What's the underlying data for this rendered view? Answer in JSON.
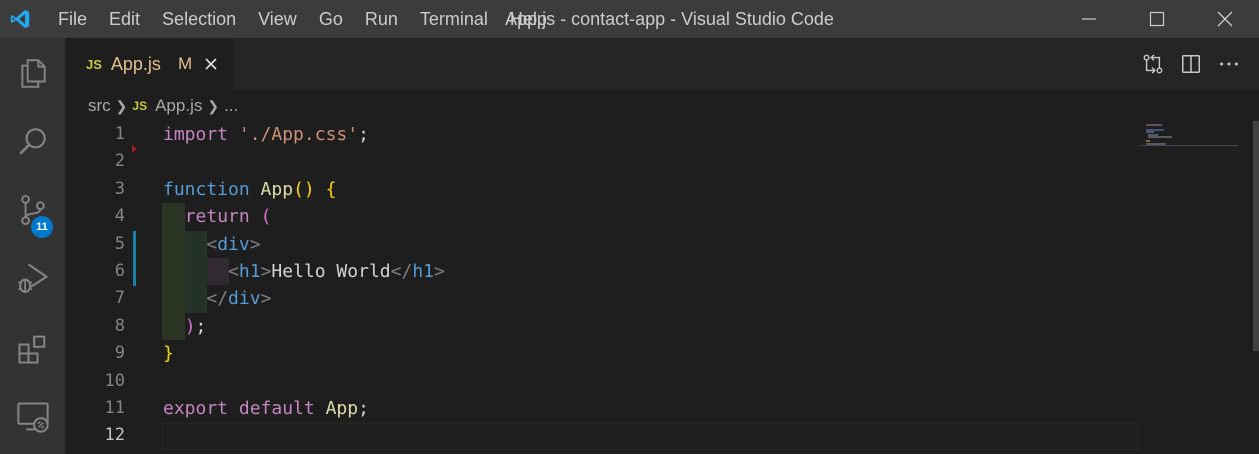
{
  "window": {
    "title": "App.js - contact-app - Visual Studio Code"
  },
  "menu": [
    {
      "id": "file",
      "label": "File"
    },
    {
      "id": "edit",
      "label": "Edit"
    },
    {
      "id": "selection",
      "label": "Selection"
    },
    {
      "id": "view",
      "label": "View"
    },
    {
      "id": "go",
      "label": "Go"
    },
    {
      "id": "run",
      "label": "Run"
    },
    {
      "id": "terminal",
      "label": "Terminal"
    },
    {
      "id": "help",
      "label": "Help"
    }
  ],
  "activity_bar": {
    "items": [
      "explorer-icon",
      "search-icon",
      "source-control-icon",
      "run-debug-icon",
      "extensions-icon",
      "remote-explorer-icon"
    ],
    "source_control_badge": "11"
  },
  "tab": {
    "file_type": "JS",
    "name": "App.js",
    "status": "M"
  },
  "breadcrumb": {
    "folder": "src",
    "file_type": "JS",
    "file": "App.js",
    "more": "..."
  },
  "editor": {
    "line_numbers": [
      "1",
      "2",
      "3",
      "4",
      "5",
      "6",
      "7",
      "8",
      "9",
      "10",
      "11",
      "12"
    ],
    "active_line": "12",
    "lines": [
      [
        [
          "kw",
          "import"
        ],
        [
          "txt",
          " "
        ],
        [
          "str",
          "'./App.css'"
        ],
        [
          "txt",
          ";"
        ]
      ],
      [],
      [
        [
          "kw2",
          "function"
        ],
        [
          "txt",
          " "
        ],
        [
          "fn",
          "App"
        ],
        [
          "br1",
          "()"
        ],
        [
          "txt",
          " "
        ],
        [
          "br1",
          "{"
        ]
      ],
      [
        [
          "txt",
          "  "
        ],
        [
          "kw",
          "return"
        ],
        [
          "txt",
          " "
        ],
        [
          "br2",
          "("
        ]
      ],
      [
        [
          "txt",
          "    "
        ],
        [
          "tagp",
          "<"
        ],
        [
          "tag",
          "div"
        ],
        [
          "tagp",
          ">"
        ]
      ],
      [
        [
          "txt",
          "      "
        ],
        [
          "tagp",
          "<"
        ],
        [
          "tag",
          "h1"
        ],
        [
          "tagp",
          ">"
        ],
        [
          "txt",
          "Hello World"
        ],
        [
          "tagp",
          "</"
        ],
        [
          "tag",
          "h1"
        ],
        [
          "tagp",
          ">"
        ]
      ],
      [
        [
          "txt",
          "    "
        ],
        [
          "tagp",
          "</"
        ],
        [
          "tag",
          "div"
        ],
        [
          "tagp",
          ">"
        ]
      ],
      [
        [
          "txt",
          "  "
        ],
        [
          "br2",
          ")"
        ],
        [
          "txt",
          ";"
        ]
      ],
      [
        [
          "br1",
          "}"
        ]
      ],
      [],
      [
        [
          "kw",
          "export"
        ],
        [
          "txt",
          " "
        ],
        [
          "kw",
          "default"
        ],
        [
          "txt",
          " "
        ],
        [
          "fn",
          "App"
        ],
        [
          "txt",
          ";"
        ]
      ],
      []
    ]
  },
  "colors": {
    "titlebar": "#3c3c3c",
    "activitybar": "#333333",
    "editor_bg": "#1e1e1e",
    "accent": "#007acc",
    "modified": "#e2c08d",
    "js_icon": "#cbcb41"
  }
}
